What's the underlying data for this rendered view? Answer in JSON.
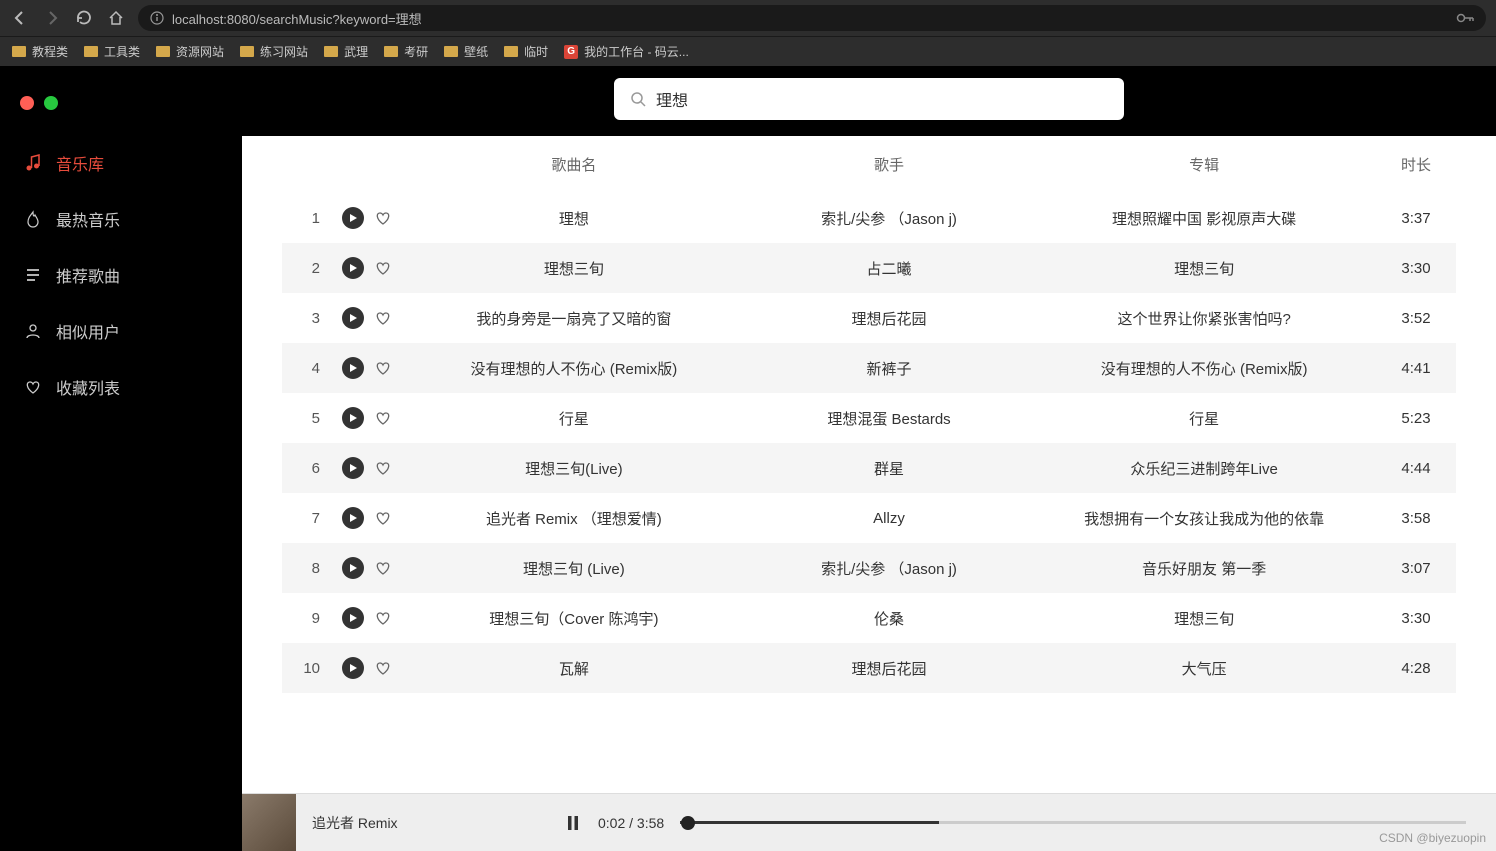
{
  "browser": {
    "url": "localhost:8080/searchMusic?keyword=理想",
    "bookmarks": [
      {
        "label": "教程类",
        "type": "folder"
      },
      {
        "label": "工具类",
        "type": "folder"
      },
      {
        "label": "资源网站",
        "type": "folder"
      },
      {
        "label": "练习网站",
        "type": "folder"
      },
      {
        "label": "武理",
        "type": "folder"
      },
      {
        "label": "考研",
        "type": "folder"
      },
      {
        "label": "壁纸",
        "type": "folder"
      },
      {
        "label": "临时",
        "type": "folder"
      },
      {
        "label": "我的工作台 - 码云...",
        "type": "link"
      }
    ]
  },
  "sidebar": {
    "items": [
      {
        "label": "音乐库",
        "icon": "music"
      },
      {
        "label": "最热音乐",
        "icon": "fire"
      },
      {
        "label": "推荐歌曲",
        "icon": "list"
      },
      {
        "label": "相似用户",
        "icon": "user"
      },
      {
        "label": "收藏列表",
        "icon": "heart"
      }
    ]
  },
  "search": {
    "value": "理想"
  },
  "table": {
    "headers": {
      "name": "歌曲名",
      "artist": "歌手",
      "album": "专辑",
      "duration": "时长"
    },
    "rows": [
      {
        "idx": "1",
        "name": "理想",
        "artist": "索扎/尖参 （Jason j)",
        "album": "理想照耀中国 影视原声大碟",
        "duration": "3:37"
      },
      {
        "idx": "2",
        "name": "理想三旬",
        "artist": "占二曦",
        "album": "理想三旬",
        "duration": "3:30"
      },
      {
        "idx": "3",
        "name": "我的身旁是一扇亮了又暗的窗",
        "artist": "理想后花园",
        "album": "这个世界让你紧张害怕吗?",
        "duration": "3:52"
      },
      {
        "idx": "4",
        "name": "没有理想的人不伤心 (Remix版)",
        "artist": "新裤子",
        "album": "没有理想的人不伤心 (Remix版)",
        "duration": "4:41"
      },
      {
        "idx": "5",
        "name": "行星",
        "artist": "理想混蛋 Bestards",
        "album": "行星",
        "duration": "5:23"
      },
      {
        "idx": "6",
        "name": "理想三旬(Live)",
        "artist": "群星",
        "album": "众乐纪三进制跨年Live",
        "duration": "4:44"
      },
      {
        "idx": "7",
        "name": "追光者 Remix （理想爱情)",
        "artist": "Allzy",
        "album": "我想拥有一个女孩让我成为他的依靠",
        "duration": "3:58"
      },
      {
        "idx": "8",
        "name": "理想三旬 (Live)",
        "artist": "索扎/尖参 （Jason j)",
        "album": "音乐好朋友 第一季",
        "duration": "3:07"
      },
      {
        "idx": "9",
        "name": "理想三旬（Cover 陈鸿宇)",
        "artist": "伦桑",
        "album": "理想三旬",
        "duration": "3:30"
      },
      {
        "idx": "10",
        "name": "瓦解",
        "artist": "理想后花园",
        "album": "大气压",
        "duration": "4:28"
      }
    ]
  },
  "player": {
    "now_playing": "追光者 Remix",
    "current_time": "0:02",
    "total_time": "3:58"
  },
  "watermark": "CSDN @biyezuopin"
}
